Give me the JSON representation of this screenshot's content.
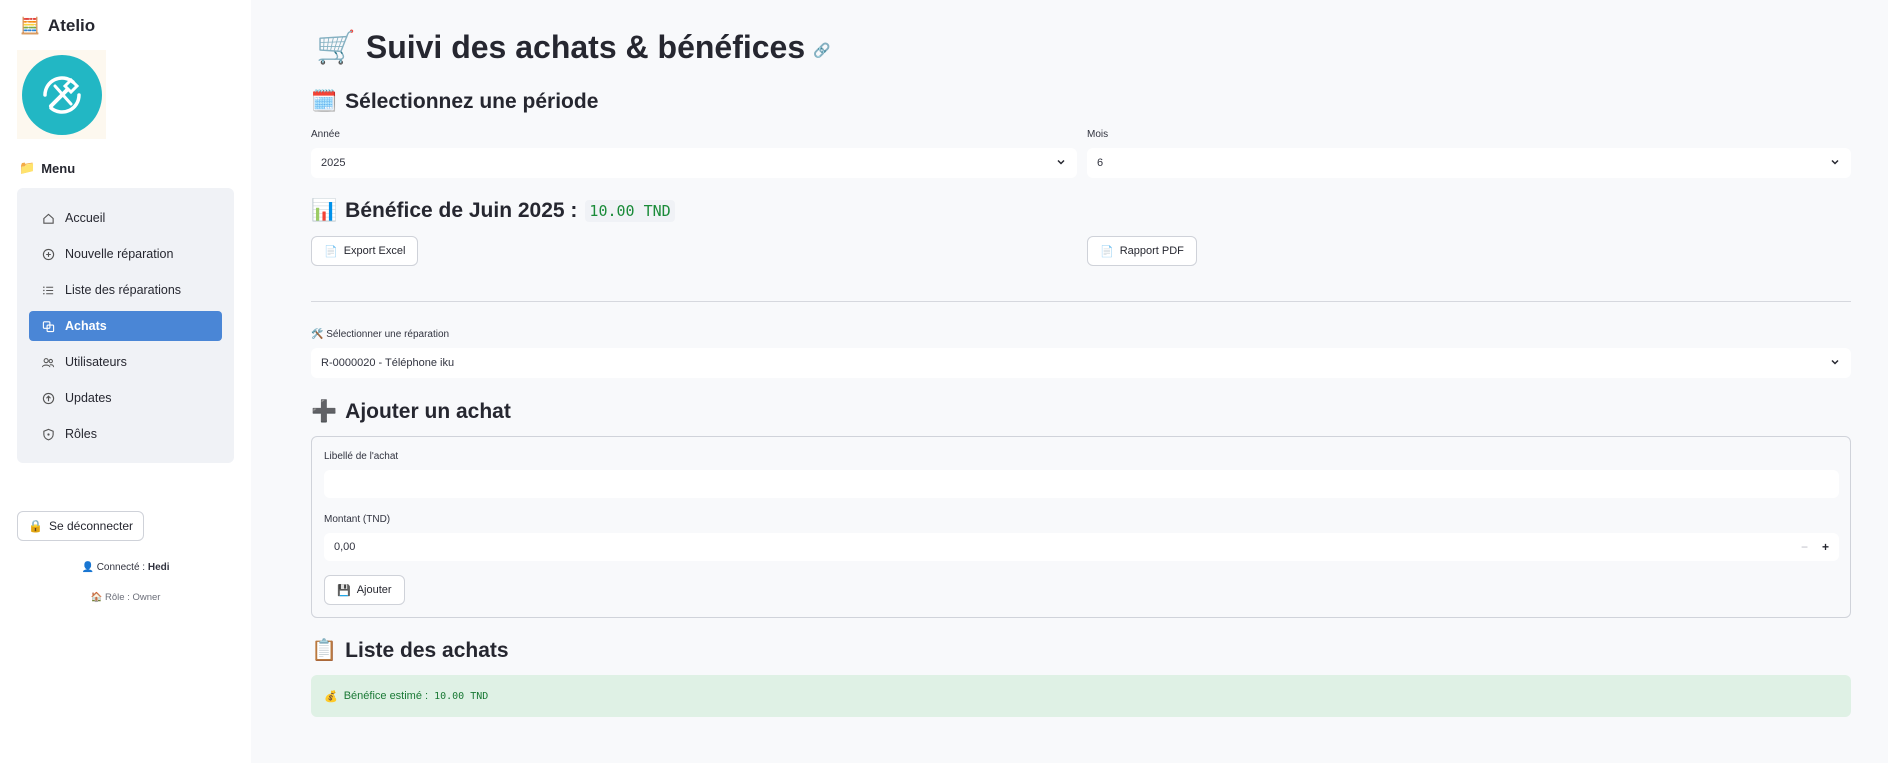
{
  "sidebar": {
    "brand_icon": "🧮",
    "brand": "Atelio",
    "logo": "wrench-screwdriver-logo",
    "menu_icon": "📁",
    "menu_title": "Menu",
    "items": [
      {
        "label": "Accueil",
        "icon": "home-icon"
      },
      {
        "label": "Nouvelle réparation",
        "icon": "plus-circle-icon"
      },
      {
        "label": "Liste des réparations",
        "icon": "list-icon"
      },
      {
        "label": "Achats",
        "icon": "purchases-icon",
        "active": true
      },
      {
        "label": "Utilisateurs",
        "icon": "users-icon"
      },
      {
        "label": "Updates",
        "icon": "arrow-up-circle-icon"
      },
      {
        "label": "Rôles",
        "icon": "shield-icon"
      }
    ],
    "logout_icon": "🔒",
    "logout_label": "Se déconnecter",
    "connected_icon": "👤",
    "connected_prefix": "Connecté :",
    "connected_user": "Hedi",
    "role_icon": "🏠",
    "role_text": "Rôle : Owner"
  },
  "main": {
    "title_icon": "🛒",
    "title": "Suivi des achats & bénéfices",
    "period_icon": "🗓️",
    "period_heading": "Sélectionnez une période",
    "year_label": "Année",
    "year_value": "2025",
    "month_label": "Mois",
    "month_value": "6",
    "benefit_icon": "📊",
    "benefit_heading": "Bénéfice de Juin 2025 :",
    "benefit_value": "10.00 TND",
    "export_icon": "📄",
    "export_label": "Export Excel",
    "report_icon": "📄",
    "report_label": "Rapport PDF",
    "repair_select_icon": "🛠️",
    "repair_select_label": "Sélectionner une réparation",
    "repair_select_value": "R-0000020 - Téléphone iku",
    "add_icon": "➕",
    "add_heading": "Ajouter un achat",
    "libelle_label": "Libellé de l'achat",
    "libelle_value": "",
    "montant_label": "Montant (TND)",
    "montant_value": "0,00",
    "minus": "−",
    "plus": "+",
    "add_button_icon": "💾",
    "add_button": "Ajouter",
    "list_icon": "📋",
    "list_heading": "Liste des achats",
    "estimate_icon": "💰",
    "estimate_label": "Bénéfice estimé :",
    "estimate_value": "10.00 TND"
  },
  "colors": {
    "accent": "#4a86d6",
    "logo": "#22b7c4",
    "success_bg": "#dff1e5",
    "success_text": "#1b7a36",
    "benefit_value": "#1a8b39"
  }
}
